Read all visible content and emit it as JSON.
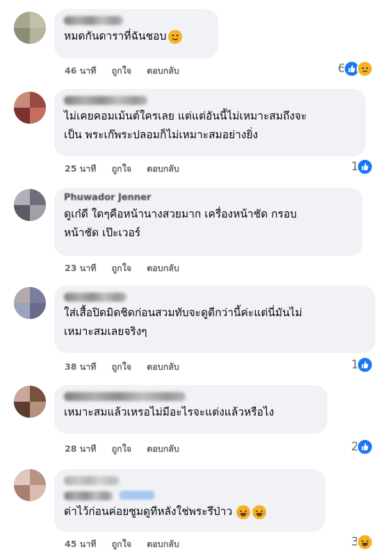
{
  "actions": {
    "like": "ถูกใจ",
    "reply": "ตอบกลับ"
  },
  "colors": {
    "like_blue": "#1877f2",
    "emoji_yellow": "#f7b125",
    "bubble_bg": "#f0f2f5",
    "meta_gray": "#65676b"
  },
  "comments": [
    {
      "author_visible": "",
      "lines": [
        "หมดกันดาราที่ฉันชอบ"
      ],
      "inline_emoji": [
        "slightly-smiling-face-icon"
      ],
      "time": "46 นาที",
      "reaction_count": "6",
      "reactions": [
        "like-icon",
        "sad-icon"
      ]
    },
    {
      "author_visible": "",
      "lines": [
        "ไม่เคยคอมเม้นต์ใครเลย แต่แต่อันนี้ไม่เหมาะสมถึงจะ",
        "เป็น พระเก๊พระปลอมก็ไม่เหมาะสมอย่างยิ่ง"
      ],
      "time": "25 นาที",
      "reaction_count": "1",
      "reactions": [
        "like-icon"
      ]
    },
    {
      "author_visible": "Phuwador Jenner",
      "lines": [
        "ดูเก๋ดี ใดๆคือหน้านางสวยมาก เครื่องหน้าชัด กรอบ",
        "หน้าชัด เป๊ะเวอร์"
      ],
      "time": "23 นาที",
      "reaction_count": "",
      "reactions": []
    },
    {
      "author_visible": "",
      "lines": [
        "ใส่เสื้อปิดมิดชิดก่อนสวมทับจะดูดีกว่านี้ค่ะแต่นี่มันไม่",
        "เหมาะสมเลยจริงๆ"
      ],
      "time": "38 นาที",
      "reaction_count": "1",
      "reactions": [
        "like-icon"
      ]
    },
    {
      "author_visible": "",
      "lines": [
        "เหมาะสมแล้วเหรอไม่มีอะไรจะแต่งแล้วหรือไง"
      ],
      "time": "28 นาที",
      "reaction_count": "2",
      "reactions": [
        "like-icon"
      ]
    },
    {
      "author_visible": "",
      "lines": [
        "ด่าไว้ก่อนค่อยซูมดูทีหลังใช่พระรึป่าว"
      ],
      "inline_emoji": [
        "laughing-tears-icon",
        "laughing-tears-icon"
      ],
      "time": "45 นาที",
      "reaction_count": "3",
      "reactions": [
        "haha-icon"
      ]
    }
  ]
}
